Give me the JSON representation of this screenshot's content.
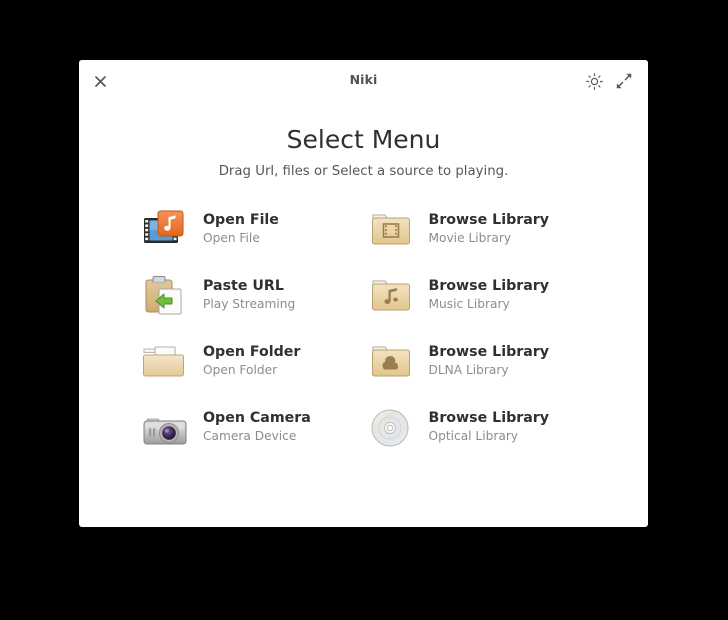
{
  "window": {
    "title": "Niki",
    "controls": [
      {
        "name": "close-icon",
        "label": "Close"
      },
      {
        "name": "brightness-icon",
        "label": "Brightness"
      },
      {
        "name": "expand-icon",
        "label": "Fullscreen"
      }
    ]
  },
  "main": {
    "heading": "Select Menu",
    "subheading": "Drag Url, files or Select a source to playing."
  },
  "entries": [
    {
      "title": "Open File",
      "subtitle": "Open File",
      "icon": "file-video-music-icon"
    },
    {
      "title": "Browse Library",
      "subtitle": "Movie Library",
      "icon": "folder-movie-icon"
    },
    {
      "title": "Paste URL",
      "subtitle": "Play Streaming",
      "icon": "clipboard-paste-icon"
    },
    {
      "title": "Browse Library",
      "subtitle": "Music Library",
      "icon": "folder-music-icon"
    },
    {
      "title": "Open Folder",
      "subtitle": "Open Folder",
      "icon": "folder-open-icon"
    },
    {
      "title": "Browse Library",
      "subtitle": "DLNA Library",
      "icon": "folder-cloud-icon"
    },
    {
      "title": "Open Camera",
      "subtitle": "Camera Device",
      "icon": "camera-icon"
    },
    {
      "title": "Browse Library",
      "subtitle": "Optical Library",
      "icon": "optical-disc-icon"
    }
  ],
  "colors": {
    "desktop_background": "#000000",
    "window_background": "#ffffff",
    "title_text": "#4f5356",
    "heading_text": "#2d3033",
    "subtitle_text": "#8a8d8f",
    "accent_orange": "#e8702a",
    "accent_blue": "#5a9bd5",
    "folder_tan": "#e6cfa0",
    "accent_green": "#6fbf3e"
  }
}
